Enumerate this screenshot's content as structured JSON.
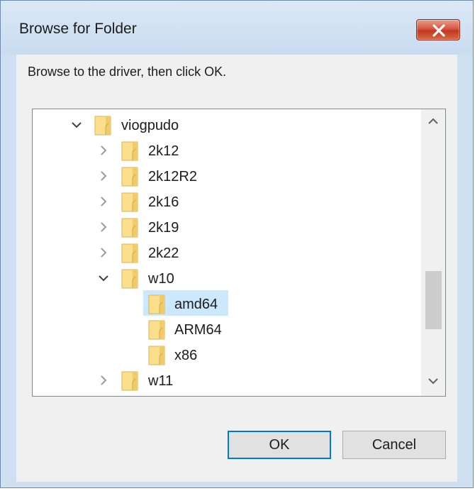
{
  "dialog": {
    "title": "Browse for Folder",
    "instruction": "Browse to the driver, then click OK."
  },
  "tree": {
    "items": [
      {
        "label": "viogpudo",
        "level": 0,
        "state": "expanded",
        "selected": false
      },
      {
        "label": "2k12",
        "level": 1,
        "state": "collapsed",
        "selected": false
      },
      {
        "label": "2k12R2",
        "level": 1,
        "state": "collapsed",
        "selected": false
      },
      {
        "label": "2k16",
        "level": 1,
        "state": "collapsed",
        "selected": false
      },
      {
        "label": "2k19",
        "level": 1,
        "state": "collapsed",
        "selected": false
      },
      {
        "label": "2k22",
        "level": 1,
        "state": "collapsed",
        "selected": false
      },
      {
        "label": "w10",
        "level": 1,
        "state": "expanded",
        "selected": false
      },
      {
        "label": "amd64",
        "level": 2,
        "state": "leaf",
        "selected": true
      },
      {
        "label": "ARM64",
        "level": 2,
        "state": "leaf",
        "selected": false
      },
      {
        "label": "x86",
        "level": 2,
        "state": "leaf",
        "selected": false
      },
      {
        "label": "w11",
        "level": 1,
        "state": "collapsed",
        "selected": false
      }
    ]
  },
  "buttons": {
    "ok": "OK",
    "cancel": "Cancel"
  },
  "colors": {
    "selection": "#cce8ff",
    "folder": "#fbd97a",
    "default_button_border": "#0078d7",
    "close_button": "#c9452c"
  }
}
